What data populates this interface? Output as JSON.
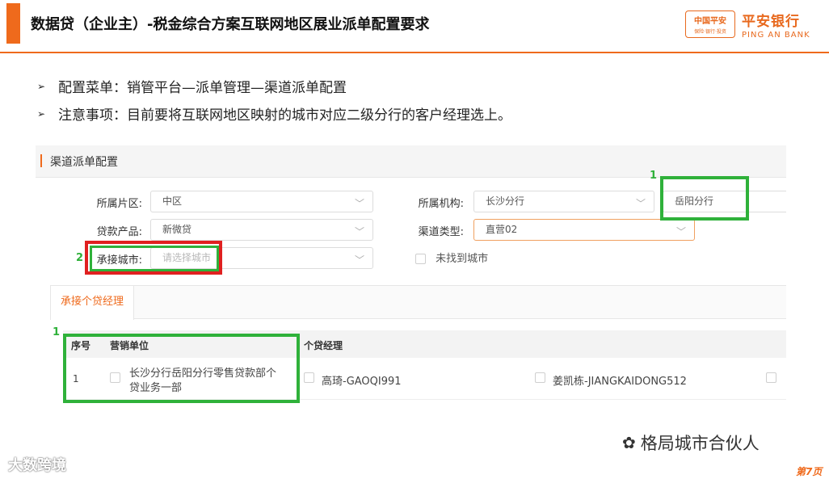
{
  "header": {
    "title": "数据贷（企业主）-税金综合方案互联网地区展业派单配置要求",
    "logo_badge": "中国平安",
    "logo_badge_sub": "保险·银行·投资",
    "logo_cn": "平安银行",
    "logo_en": "PING AN BANK"
  },
  "bullets": [
    {
      "icon": "➢",
      "text": "配置菜单：销管平台—派单管理—渠道派单配置"
    },
    {
      "icon": "➢",
      "text": "注意事项：目前要将互联网地区映射的城市对应二级分行的客户经理选上。"
    }
  ],
  "ui": {
    "panel_title": "渠道派单配置",
    "form": {
      "region_label": "所属片区:",
      "region_value": "中区",
      "org_label": "所属机构:",
      "org_value": "长沙分行",
      "org_sub_value": "岳阳分行",
      "product_label": "贷款产品:",
      "product_value": "新微贷",
      "channel_label": "渠道类型:",
      "channel_value": "直营02",
      "city_label": "承接城市:",
      "city_placeholder": "请选择城市",
      "not_found_label": "未找到城市"
    },
    "tab_label": "承接个贷经理",
    "table": {
      "headers": [
        "序号",
        "营销单位",
        "个贷经理"
      ],
      "rows": [
        {
          "index": "1",
          "unit_line1": "长沙分行岳阳分行零售贷款部个",
          "unit_line2": "贷业务一部",
          "managers": [
            "高琦-GAOQI991",
            "姜凯栋-JIANGKAIDONG512"
          ]
        }
      ]
    },
    "annotations": [
      "1",
      "2",
      "1"
    ],
    "highlight_colors": {
      "green": "#2fb13a",
      "red": "#e02020"
    }
  },
  "watermark": {
    "left": "大数跨境",
    "right": "格局城市合伙人"
  },
  "page_number": "第7页",
  "colors": {
    "accent": "#ef6a1c"
  }
}
